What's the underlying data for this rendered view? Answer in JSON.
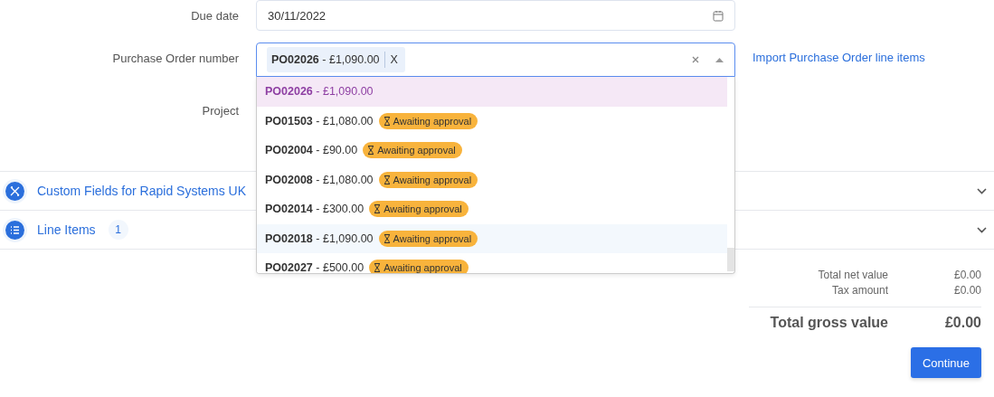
{
  "form": {
    "due_date": {
      "label": "Due date",
      "value": "30/11/2022"
    },
    "purchase_order": {
      "label": "Purchase Order number",
      "chips": [
        {
          "label": "**PO02026** - £1,090.00",
          "remove": "X"
        }
      ],
      "expanded": true,
      "options": [
        {
          "label": "**PO02026** - £1,090.00",
          "selected": true,
          "highlighted": false
        },
        {
          "label": "**PO01503** - £1,080.00",
          "status": "Awaiting approval",
          "selected": false,
          "highlighted": false
        },
        {
          "label": "**PO02004** - £90.00",
          "status": "Awaiting approval",
          "selected": false,
          "highlighted": false
        },
        {
          "label": "**PO02008** - £1,080.00",
          "status": "Awaiting approval",
          "selected": false,
          "highlighted": false
        },
        {
          "label": "**PO02014** - £300.00",
          "status": "Awaiting approval",
          "selected": false,
          "highlighted": false
        },
        {
          "label": "**PO02018** - £1,090.00",
          "status": "Awaiting approval",
          "selected": false,
          "highlighted": true
        },
        {
          "label": "**PO02027** - £500.00",
          "status": "Awaiting approval",
          "selected": false,
          "highlighted": false
        }
      ]
    },
    "import_link": "Import Purchase Order line items",
    "project": {
      "label": "Project"
    }
  },
  "sections": [
    {
      "kind": "tools",
      "title": "Custom Fields for Rapid Systems UK",
      "expanded": false
    },
    {
      "kind": "list",
      "title": "Line Items",
      "count": "1",
      "expanded": false
    }
  ],
  "totals": [
    {
      "label": "Total net value",
      "value": "£0.00",
      "kind": "minor"
    },
    {
      "label": "Tax amount",
      "value": "£0.00",
      "kind": "minor"
    },
    {
      "label": "Total gross value",
      "value": "£0.00",
      "kind": "major"
    }
  ],
  "continue_button": "Continue"
}
